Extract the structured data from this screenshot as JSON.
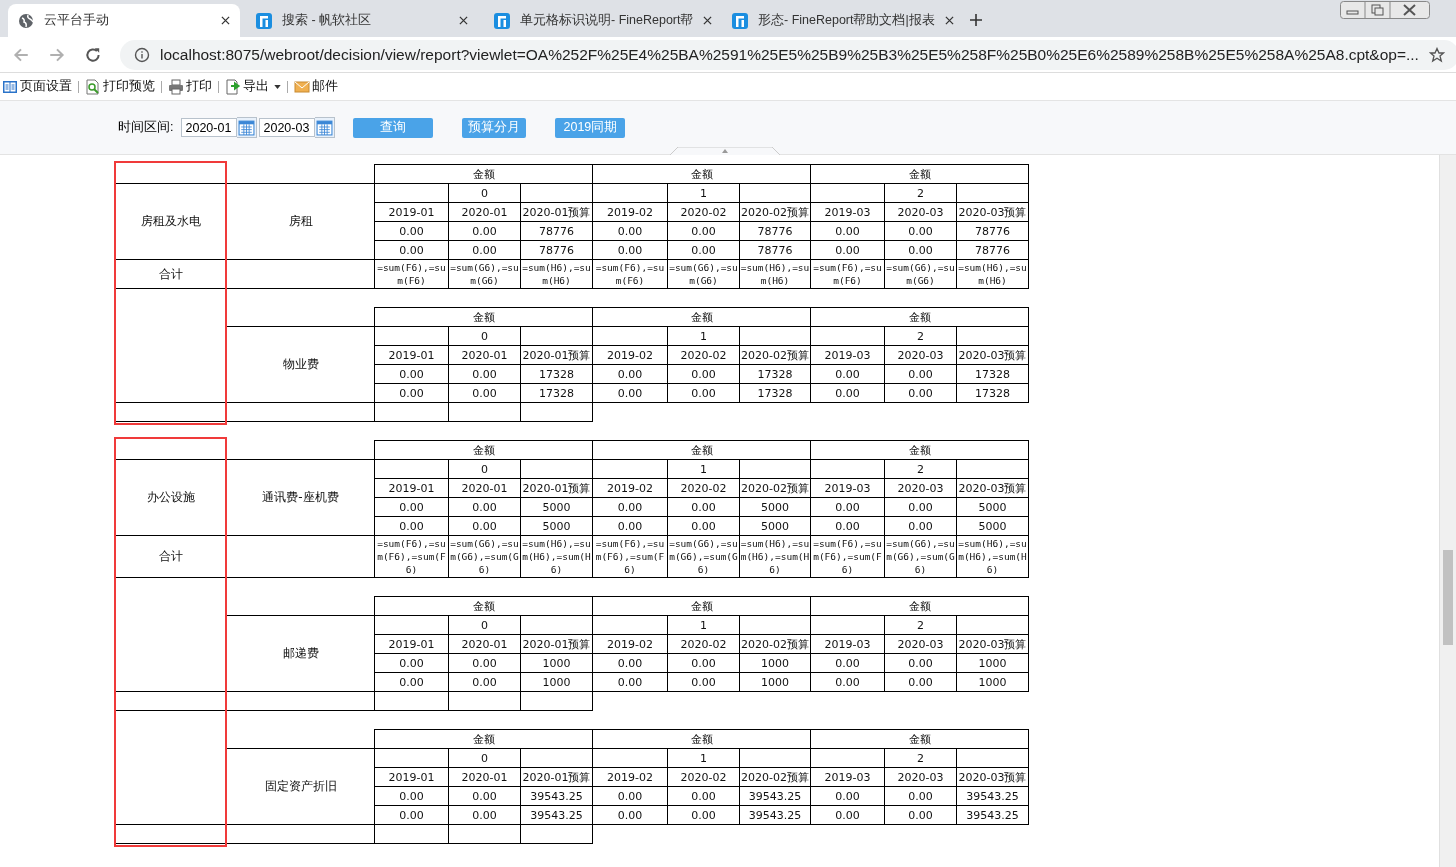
{
  "browser": {
    "tabs": [
      {
        "title": "云平台手动",
        "selected": true
      },
      {
        "title": "搜索 - 帆软社区",
        "selected": false
      },
      {
        "title": "单元格标识说明- FineReport帮",
        "selected": false
      },
      {
        "title": "形态- FineReport帮助文档|报表",
        "selected": false
      }
    ],
    "address": "localhost:8075/webroot/decision/view/report?viewlet=OA%252F%25E4%25BA%2591%25E5%25B9%25B3%25E5%258F%25B0%25E6%2589%258B%25E5%258A%25A8.cpt&op=..."
  },
  "toolbar": [
    {
      "label": "页面设置",
      "dropdown": false
    },
    {
      "label": "打印预览",
      "dropdown": false
    },
    {
      "label": "打印",
      "dropdown": false
    },
    {
      "label": "导出",
      "dropdown": true
    },
    {
      "label": "邮件",
      "dropdown": false
    }
  ],
  "query": {
    "label": "时间区间:",
    "start": "2020-01",
    "end": "2020-03",
    "buttons": [
      "查询",
      "预算分月",
      "2019同期"
    ]
  },
  "report": {
    "groups": [
      {
        "category": "房租及水电",
        "total_label": "合计",
        "highlighted": true,
        "items": [
          {
            "name": "房租",
            "header": [
              "金额",
              "金额",
              "金额"
            ],
            "index": [
              "0",
              "1",
              "2"
            ],
            "months": [
              "2019-01",
              "2020-01",
              "2020-01预算",
              "2019-02",
              "2020-02",
              "2020-02预算",
              "2019-03",
              "2020-03",
              "2020-03预算"
            ],
            "rows": [
              [
                "0.00",
                "0.00",
                "78776",
                "0.00",
                "0.00",
                "78776",
                "0.00",
                "0.00",
                "78776"
              ],
              [
                "0.00",
                "0.00",
                "78776",
                "0.00",
                "0.00",
                "78776",
                "0.00",
                "0.00",
                "78776"
              ]
            ],
            "sum": [
              "=sum(F6),=sum(F6)",
              "=sum(G6),=sum(G6)",
              "=sum(H6),=sum(H6)",
              "=sum(F6),=sum(F6)",
              "=sum(G6),=sum(G6)",
              "=sum(H6),=sum(H6)",
              "=sum(F6),=sum(F6)",
              "=sum(G6),=sum(G6)",
              "=sum(H6),=sum(H6)"
            ]
          },
          {
            "name": "物业费",
            "header": [
              "金额",
              "金额",
              "金额"
            ],
            "index": [
              "0",
              "1",
              "2"
            ],
            "months": [
              "2019-01",
              "2020-01",
              "2020-01预算",
              "2019-02",
              "2020-02",
              "2020-02预算",
              "2019-03",
              "2020-03",
              "2020-03预算"
            ],
            "rows": [
              [
                "0.00",
                "0.00",
                "17328",
                "0.00",
                "0.00",
                "17328",
                "0.00",
                "0.00",
                "17328"
              ],
              [
                "0.00",
                "0.00",
                "17328",
                "0.00",
                "0.00",
                "17328",
                "0.00",
                "0.00",
                "17328"
              ]
            ]
          }
        ]
      },
      {
        "category": "办公设施",
        "total_label": "合计",
        "highlighted": true,
        "items": [
          {
            "name": "通讯费-座机费",
            "header": [
              "金额",
              "金额",
              "金额"
            ],
            "index": [
              "0",
              "1",
              "2"
            ],
            "months": [
              "2019-01",
              "2020-01",
              "2020-01预算",
              "2019-02",
              "2020-02",
              "2020-02预算",
              "2019-03",
              "2020-03",
              "2020-03预算"
            ],
            "rows": [
              [
                "0.00",
                "0.00",
                "5000",
                "0.00",
                "0.00",
                "5000",
                "0.00",
                "0.00",
                "5000"
              ],
              [
                "0.00",
                "0.00",
                "5000",
                "0.00",
                "0.00",
                "5000",
                "0.00",
                "0.00",
                "5000"
              ]
            ],
            "sum": [
              "=sum(F6),=sum(F6),=sum(F6)",
              "=sum(G6),=sum(G6),=sum(G6)",
              "=sum(H6),=sum(H6),=sum(H6)",
              "=sum(F6),=sum(F6),=sum(F6)",
              "=sum(G6),=sum(G6),=sum(G6)",
              "=sum(H6),=sum(H6),=sum(H6)",
              "=sum(F6),=sum(F6),=sum(F6)",
              "=sum(G6),=sum(G6),=sum(G6)",
              "=sum(H6),=sum(H6),=sum(H6)"
            ]
          },
          {
            "name": "邮递费",
            "header": [
              "金额",
              "金额",
              "金额"
            ],
            "index": [
              "0",
              "1",
              "2"
            ],
            "months": [
              "2019-01",
              "2020-01",
              "2020-01预算",
              "2019-02",
              "2020-02",
              "2020-02预算",
              "2019-03",
              "2020-03",
              "2020-03预算"
            ],
            "rows": [
              [
                "0.00",
                "0.00",
                "1000",
                "0.00",
                "0.00",
                "1000",
                "0.00",
                "0.00",
                "1000"
              ],
              [
                "0.00",
                "0.00",
                "1000",
                "0.00",
                "0.00",
                "1000",
                "0.00",
                "0.00",
                "1000"
              ]
            ]
          },
          {
            "name": "固定资产折旧",
            "header": [
              "金额",
              "金额",
              "金额"
            ],
            "index": [
              "0",
              "1",
              "2"
            ],
            "months": [
              "2019-01",
              "2020-01",
              "2020-01预算",
              "2019-02",
              "2020-02",
              "2020-02预算",
              "2019-03",
              "2020-03",
              "2020-03预算"
            ],
            "rows": [
              [
                "0.00",
                "0.00",
                "39543.25",
                "0.00",
                "0.00",
                "39543.25",
                "0.00",
                "0.00",
                "39543.25"
              ],
              [
                "0.00",
                "0.00",
                "39543.25",
                "0.00",
                "0.00",
                "39543.25",
                "0.00",
                "0.00",
                "39543.25"
              ]
            ]
          }
        ]
      }
    ]
  }
}
